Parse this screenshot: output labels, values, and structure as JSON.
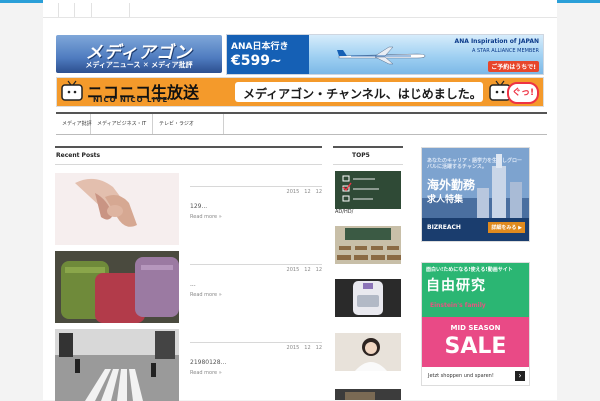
{
  "site": {
    "logo_text": "メディアゴン",
    "logo_sub": "メディアニュース ✕ メディア批評"
  },
  "ads": {
    "ana": {
      "route": "ANA日本行き",
      "price": "€599~",
      "brand": "ANA Inspiration of JAPAN",
      "alliance": "A STAR ALLIANCE MEMBER",
      "cta": "ご予約はうちで!"
    },
    "nico": {
      "logo": "ニコニコ生放送",
      "logo_sub": "NICO NICO LIVE",
      "message": "メディアゴン・チャンネル、はじめました。",
      "badge": "ぐっ!"
    },
    "bizreach": {
      "copy": "あなたのキャリア・語学力を生かしグローバルに活躍するチャンス。",
      "title1": "海外勤務",
      "title2": "求人特集",
      "brand": "BIZREACH",
      "cta": "詳細をみる ▶"
    },
    "sale": {
      "top": "面白い!ためになる!使える!動画サイト",
      "title": "自由研究",
      "brand": "Einstein's family",
      "season": "MID SEASON",
      "sale": "SALE",
      "footer": "Jetzt shoppen und sparen!",
      "arrow": "›"
    }
  },
  "nav": {
    "items": [
      "メディア批評",
      "メディアビジネス・IT",
      "テレビ・ラジオ"
    ]
  },
  "recent": {
    "heading": "Recent Posts",
    "posts": [
      {
        "date": "2015　12　12",
        "excerpt": "129...",
        "more": "Read more »"
      },
      {
        "date": "2015　12　12",
        "excerpt": "...",
        "more": "Read more »"
      },
      {
        "date": "2015　12　12",
        "excerpt": "21980128...",
        "more": "Read more »"
      }
    ]
  },
  "top5": {
    "heading": "TOP5",
    "first_label": "AD/HD/"
  },
  "colors": {
    "accent": "#2a9fd8",
    "nico_orange": "#f49a2b",
    "sale_pink": "#e94a86",
    "sale_green": "#2bb673"
  }
}
